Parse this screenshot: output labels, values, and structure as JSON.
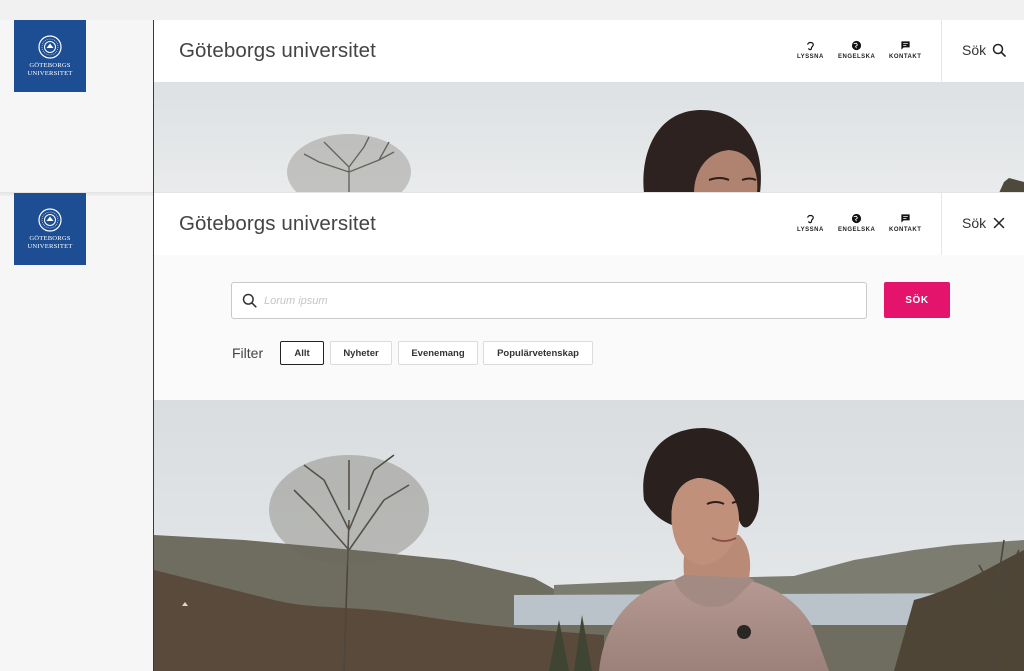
{
  "logo": {
    "line1": "GÖTEBORGS",
    "line2": "UNIVERSITET"
  },
  "header": {
    "title": "Göteborgs universitet",
    "utilities": {
      "listen": "LYSSNA",
      "english": "ENGELSKA",
      "contact": "KONTAKT"
    },
    "search_label": "Sök"
  },
  "search_panel": {
    "placeholder": "Lorum ipsum",
    "submit_label": "SÖK",
    "filter_label": "Filter",
    "filters": [
      "Allt",
      "Nyheter",
      "Evenemang",
      "Populärvetenskap"
    ],
    "active_filter": "Allt"
  },
  "icons": {
    "listen": "ear-icon",
    "english": "globe-icon",
    "contact": "chat-bubble-icon",
    "search": "search-icon",
    "close": "close-icon"
  },
  "colors": {
    "brand_blue": "#1d4d92",
    "accent_pink": "#e4136b"
  }
}
